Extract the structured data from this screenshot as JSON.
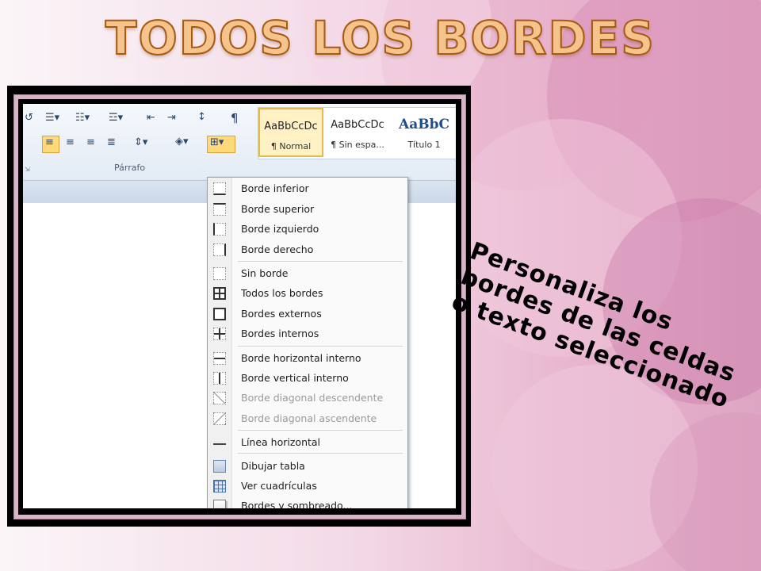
{
  "slide": {
    "title": "TODOS LOS BORDES",
    "annotation_lines": [
      "Personaliza los",
      "bordes de las celdas",
      "o texto seleccionado"
    ],
    "colors": {
      "title_fill": "#f5c48c",
      "title_stroke": "#a65a12",
      "background_pink": "#e8b6cf",
      "frame": "#000000"
    }
  },
  "ribbon": {
    "group_label": "Párrafo",
    "icons": [
      "bullets-icon",
      "numbering-icon",
      "multilevel-list-icon",
      "decrease-indent-icon",
      "increase-indent-icon",
      "sort-icon",
      "show-marks-icon",
      "align-left-icon",
      "center-icon",
      "align-right-icon",
      "justify-icon",
      "line-spacing-icon",
      "shading-icon",
      "borders-icon"
    ],
    "pilcrow": "¶",
    "styles": [
      {
        "sample": "AaBbCcDc",
        "name": "¶ Normal"
      },
      {
        "sample": "AaBbCcDc",
        "name": "¶ Sin espa..."
      },
      {
        "sample": "AaBbC",
        "name": "Título 1"
      }
    ]
  },
  "menu": {
    "items": [
      {
        "label": "Borde inferior",
        "icon": "border-bottom-icon"
      },
      {
        "label": "Borde superior",
        "icon": "border-top-icon"
      },
      {
        "label": "Borde izquierdo",
        "icon": "border-left-icon"
      },
      {
        "label": "Borde derecho",
        "icon": "border-right-icon"
      },
      {
        "label": "Sin borde",
        "icon": "no-border-icon"
      },
      {
        "label": "Todos los bordes",
        "icon": "all-borders-icon"
      },
      {
        "label": "Bordes externos",
        "icon": "outside-borders-icon"
      },
      {
        "label": "Bordes internos",
        "icon": "inside-borders-icon"
      },
      {
        "label": "Borde horizontal interno",
        "icon": "inside-horizontal-border-icon"
      },
      {
        "label": "Borde vertical interno",
        "icon": "inside-vertical-border-icon"
      },
      {
        "label": "Borde diagonal descendente",
        "icon": "diagonal-down-border-icon"
      },
      {
        "label": "Borde diagonal ascendente",
        "icon": "diagonal-up-border-icon"
      },
      {
        "label": "Línea horizontal",
        "icon": "horizontal-line-icon"
      },
      {
        "label": "Dibujar tabla",
        "icon": "draw-table-icon"
      },
      {
        "label": "Ver cuadrículas",
        "icon": "view-gridlines-icon"
      },
      {
        "label": "Bordes y sombreado...",
        "icon": "borders-shading-icon"
      }
    ]
  }
}
